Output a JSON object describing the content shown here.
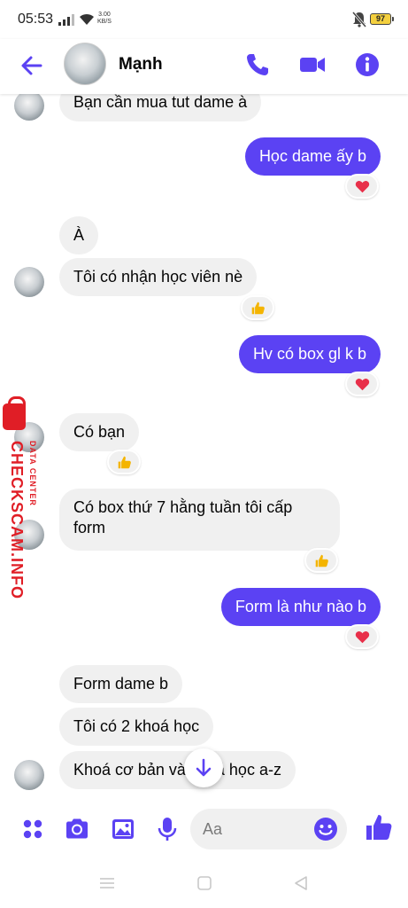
{
  "status_bar": {
    "time": "05:53",
    "net_speed_value": "3.00",
    "net_speed_unit": "KB/S",
    "battery": "97"
  },
  "header": {
    "contact_name": "Mạnh"
  },
  "messages": [
    {
      "text": "Bạn cần mua tut dame à",
      "direction": "incoming"
    },
    {
      "text": "Học dame ấy b",
      "direction": "outgoing",
      "reaction": "heart"
    },
    {
      "text": "À",
      "direction": "incoming"
    },
    {
      "text": "Tôi có nhận học viên nè",
      "direction": "incoming",
      "reaction": "thumbs-up"
    },
    {
      "text": "Hv có box gl k b",
      "direction": "outgoing",
      "reaction": "heart"
    },
    {
      "text": "Có bạn",
      "direction": "incoming",
      "reaction": "thumbs-up"
    },
    {
      "text_line1": "Có box thứ 7 hằng tuần tôi cấp",
      "text_line2": "form",
      "direction": "incoming",
      "reaction": "thumbs-up"
    },
    {
      "text": "Form là như nào b",
      "direction": "outgoing",
      "reaction": "heart"
    },
    {
      "text": "Form dame b",
      "direction": "incoming"
    },
    {
      "text": "Tôi có 2 khoá học",
      "direction": "incoming"
    },
    {
      "text": "Khoá cơ bản và khoá học a-z",
      "direction": "incoming"
    }
  ],
  "composer": {
    "placeholder": "Aa"
  },
  "watermark": {
    "main": "CHECKSCAM.INFO",
    "sub": "DATA CENTER"
  },
  "colors": {
    "accent": "#5b42f3",
    "incoming_bubble": "#f0f0f0",
    "heart": "#e8304a",
    "thumb": "#f4b400",
    "watermark": "#e01e26"
  }
}
